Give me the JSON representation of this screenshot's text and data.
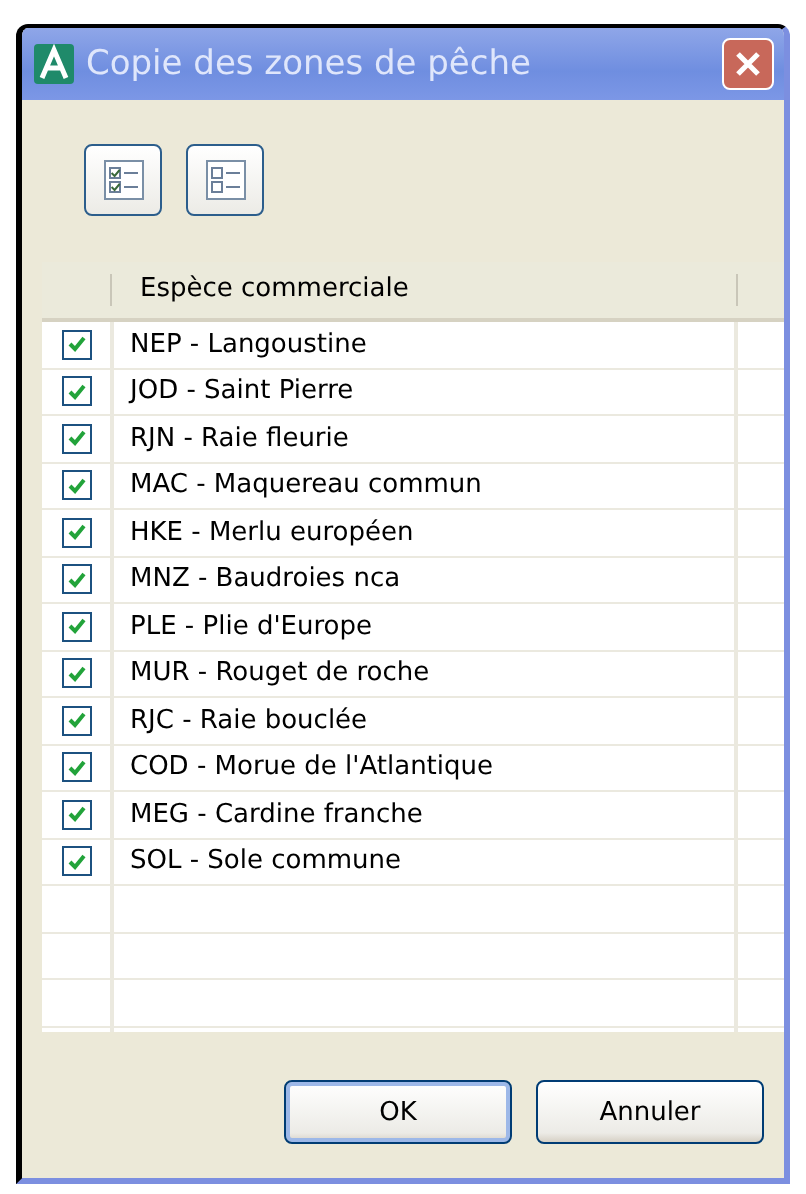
{
  "window": {
    "title": "Copie des zones de pêche"
  },
  "toolbar": [
    {
      "kind": "check-all"
    },
    {
      "kind": "uncheck-all"
    }
  ],
  "table": {
    "columns": [
      "Espèce commerciale"
    ],
    "rows": [
      {
        "label": "NEP - Langoustine",
        "checked": true
      },
      {
        "label": "JOD - Saint Pierre",
        "checked": true
      },
      {
        "label": "RJN - Raie fleurie",
        "checked": true
      },
      {
        "label": "MAC - Maquereau commun",
        "checked": true
      },
      {
        "label": "HKE - Merlu européen",
        "checked": true
      },
      {
        "label": "MNZ - Baudroies nca",
        "checked": true
      },
      {
        "label": "PLE - Plie d'Europe",
        "checked": true
      },
      {
        "label": "MUR - Rouget de roche",
        "checked": true
      },
      {
        "label": "RJC - Raie bouclée",
        "checked": true
      },
      {
        "label": "COD - Morue de l'Atlantique",
        "checked": true
      },
      {
        "label": "MEG - Cardine franche",
        "checked": true
      },
      {
        "label": "SOL - Sole commune",
        "checked": true
      }
    ]
  },
  "buttons": [
    "OK",
    "Annuler"
  ]
}
